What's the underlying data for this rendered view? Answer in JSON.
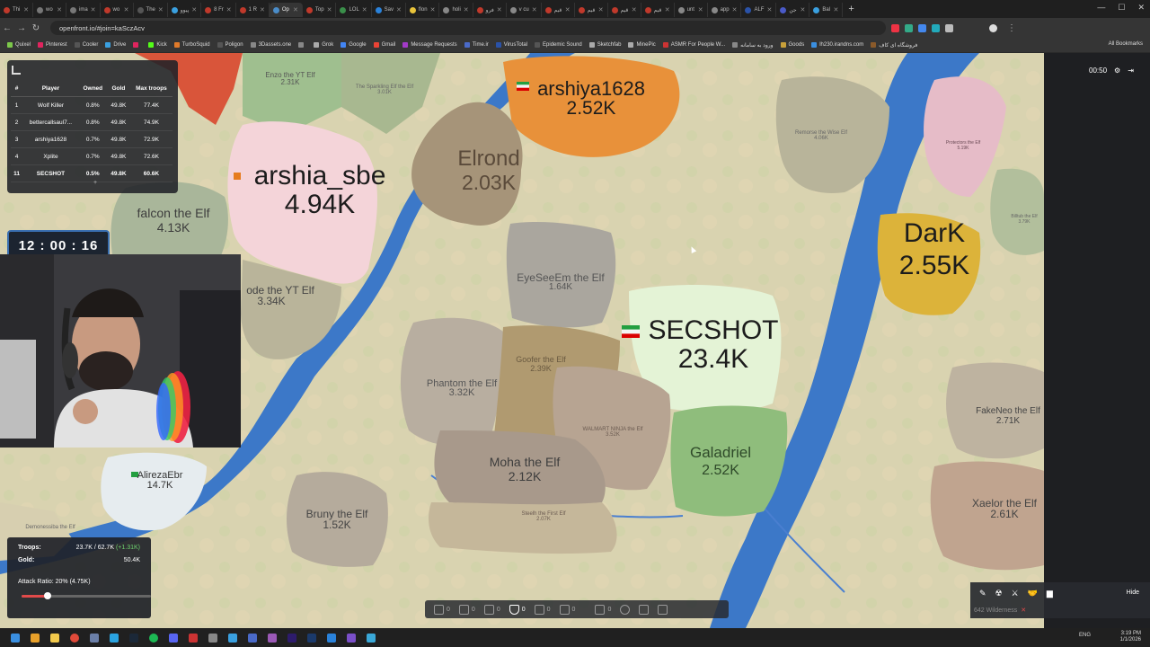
{
  "browser": {
    "tabs": [
      {
        "label": "Thi"
      },
      {
        "label": "wo"
      },
      {
        "label": "ima"
      },
      {
        "label": "wo"
      },
      {
        "label": "The"
      },
      {
        "label": "پیوو"
      },
      {
        "label": "8 Fr"
      },
      {
        "label": "1 R"
      },
      {
        "label": "Op",
        "active": true
      },
      {
        "label": "Top"
      },
      {
        "label": "LOL"
      },
      {
        "label": "Sav"
      },
      {
        "label": "flon"
      },
      {
        "label": "holi"
      },
      {
        "label": "فرو"
      },
      {
        "label": "v cu"
      },
      {
        "label": "قیم"
      },
      {
        "label": "قیم"
      },
      {
        "label": "قیم"
      },
      {
        "label": "قیم"
      },
      {
        "label": "unt"
      },
      {
        "label": "app"
      },
      {
        "label": "ALF"
      },
      {
        "label": "جن"
      },
      {
        "label": "Bal"
      }
    ],
    "url": "openfront.io/#join=kaSczAcv",
    "bookmarks": [
      "Quixel",
      "Pinterest",
      "Cooler",
      "Drive",
      "",
      "Kick",
      "TurboSquid",
      "Poligon",
      "3Dassets.one",
      "",
      "Grok",
      "Google",
      "Gmail",
      "Message Requests",
      "Time.ir",
      "VirusTotal",
      "Epidemic Sound",
      "Sketchfab",
      "MinePic",
      "ASMR For People W...",
      "ورود به سامانه",
      "Goods",
      "lh230.irandns.com",
      "فروشگاه ای کاف"
    ],
    "all_bookmarks": "All Bookmarks"
  },
  "leaderboard": {
    "headers": [
      "#",
      "Player",
      "Owned",
      "Gold",
      "Max troops"
    ],
    "rows": [
      {
        "rank": "1",
        "player": "Wolf Killer",
        "owned": "0.8%",
        "gold": "49.8K",
        "max": "77.4K"
      },
      {
        "rank": "2",
        "player": "bettercallsaul7...",
        "owned": "0.8%",
        "gold": "49.8K",
        "max": "74.9K"
      },
      {
        "rank": "3",
        "player": "arshiya1628",
        "owned": "0.7%",
        "gold": "49.8K",
        "max": "72.9K"
      },
      {
        "rank": "4",
        "player": "Xplite",
        "owned": "0.7%",
        "gold": "49.8K",
        "max": "72.6K"
      },
      {
        "rank": "11",
        "player": "SECSHOT",
        "owned": "0.5%",
        "gold": "49.8K",
        "max": "60.6K"
      }
    ],
    "expand": "+"
  },
  "overlay_clock": "12 : 00 : 16",
  "game_timer": "00:50",
  "territories": [
    {
      "name": "arshiya1628",
      "troops": "2.52K",
      "big": true
    },
    {
      "name": "arshia_sbe",
      "troops": "4.94K",
      "big": true
    },
    {
      "name": "Elrond",
      "troops": "2.03K",
      "big": true
    },
    {
      "name": "SECSHOT",
      "troops": "23.4K",
      "big": true
    },
    {
      "name": "DarK",
      "troops": "2.55K",
      "big": true
    },
    {
      "name": "falcon the Elf",
      "troops": "4.13K"
    },
    {
      "name": "EyeSeeEm the Elf",
      "troops": "1.64K"
    },
    {
      "name": "Phantom the Elf",
      "troops": "3.32K"
    },
    {
      "name": "Goofer the Elf",
      "troops": "2.39K"
    },
    {
      "name": "Moha the Elf",
      "troops": "2.12K"
    },
    {
      "name": "Galadriel",
      "troops": "2.52K"
    },
    {
      "name": "AlirezaEbr",
      "troops": "14.7K"
    },
    {
      "name": "Bruny the Elf",
      "troops": "1.52K"
    },
    {
      "name": "FakeNeo the Elf",
      "troops": "2.71K"
    },
    {
      "name": "Xaelor the Elf",
      "troops": "2.61K"
    },
    {
      "name": "Enzo the YT Elf",
      "troops": "2.31K"
    },
    {
      "name": "The Sparkling Elf the Elf",
      "troops": "3.01K"
    },
    {
      "name": "Remorse the Wise Elf",
      "troops": "4.06K"
    },
    {
      "name": "Protectors the Elf",
      "troops": "5.19K"
    },
    {
      "name": "Billtub the Elf",
      "troops": "3.79K"
    },
    {
      "name": "WALMART NINJA the Elf",
      "troops": "3.52K"
    },
    {
      "name": "Steelh the First Elf",
      "troops": "2.07K"
    },
    {
      "name": "Demonessiba the Elf",
      "troops": ""
    },
    {
      "name": "ode the YT Elf",
      "troops": "3.34K"
    }
  ],
  "stats": {
    "troops_label": "Troops:",
    "troops_value": "23.7K / 62.7K",
    "troops_delta": "(+1.31K)",
    "gold_label": "Gold:",
    "gold_value": "50.4K",
    "attack_ratio": "Attack Ratio: 20% (4.75K)",
    "attack_ratio_fraction": 0.2
  },
  "build": [
    "0",
    "0",
    "0",
    "0",
    "0",
    "0",
    "0"
  ],
  "chat": {
    "hide": "Hide",
    "wilderness": "642 Wilderness"
  },
  "taskbar": {
    "lang": "ENG",
    "time": "3:19 PM",
    "date": "1/1/2026"
  }
}
